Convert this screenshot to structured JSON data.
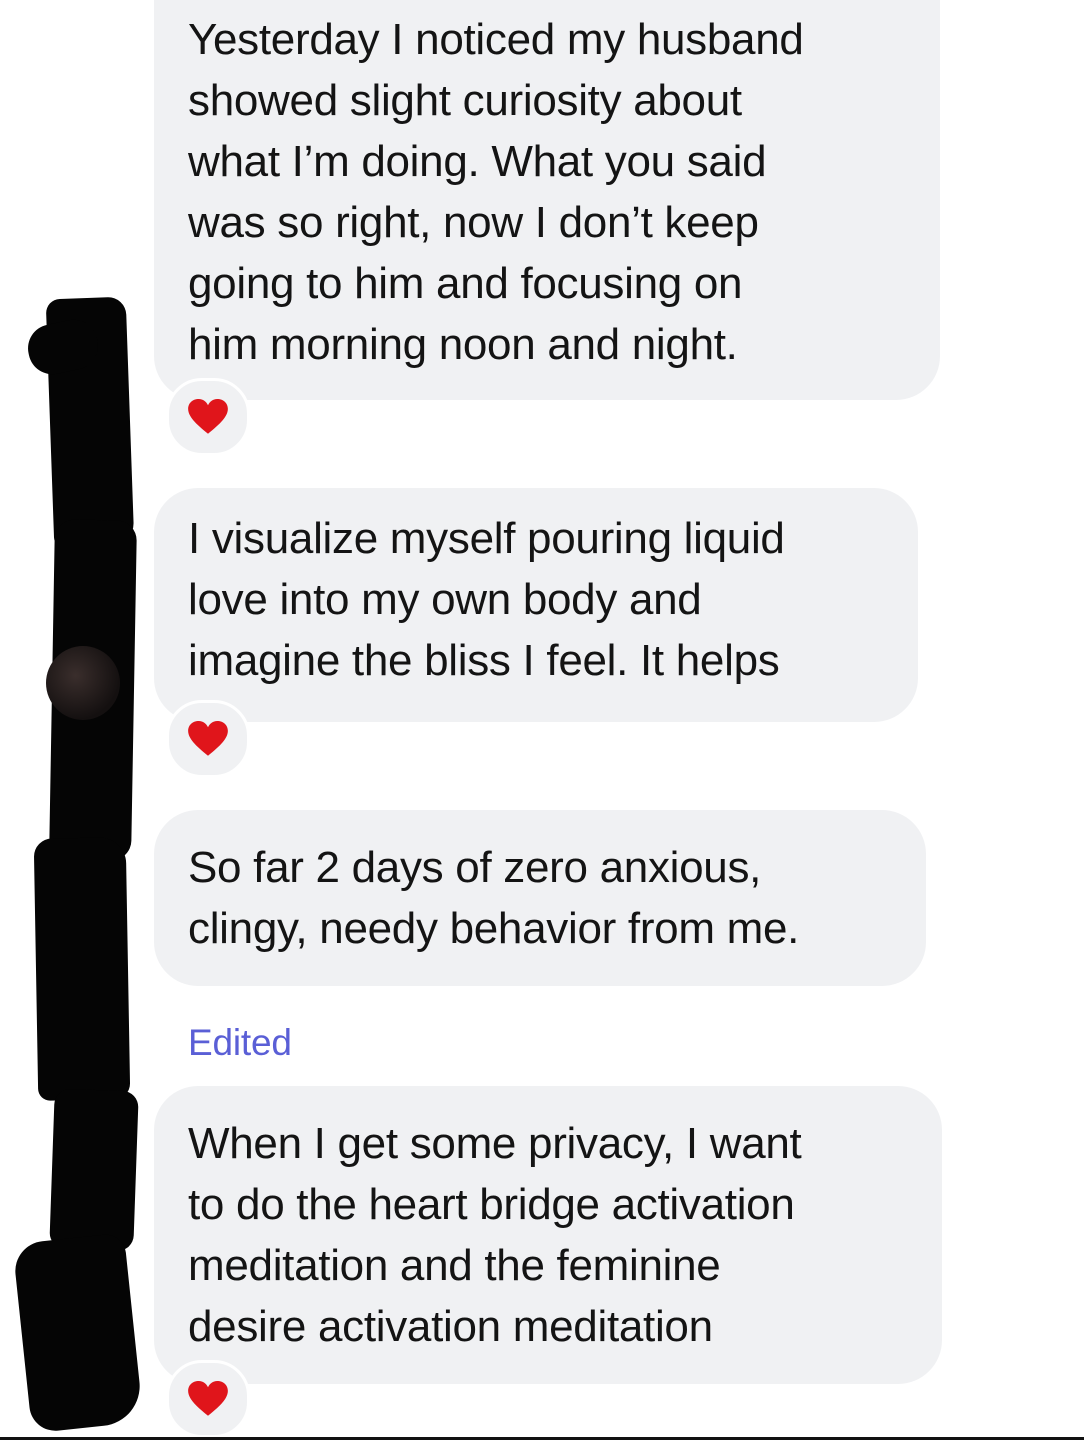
{
  "messages": [
    {
      "text": "Yesterday I noticed my husband\nshowed slight curiosity about\nwhat I’m doing.  What you said\nwas so right, now I don’t keep\ngoing to him and focusing on\nhim morning noon and night.",
      "reaction": "heart"
    },
    {
      "text": "I visualize myself pouring liquid\nlove into my own body and\nimagine the bliss I feel. It helps",
      "reaction": "heart"
    },
    {
      "text": "So far 2 days of zero anxious,\nclingy, needy behavior from me.",
      "reaction": null
    },
    {
      "text": "When I get some privacy, I want\nto do the heart bridge activation\nmeditation and the feminine\ndesire activation meditation",
      "reaction": "heart"
    }
  ],
  "edited_label": "Edited",
  "colors": {
    "bubble": "#f0f1f3",
    "text": "#141414",
    "edited": "#5a5fd6",
    "heart": "#e0151b",
    "redaction": "#050505"
  },
  "icons": {
    "reaction": "red-heart-icon"
  }
}
